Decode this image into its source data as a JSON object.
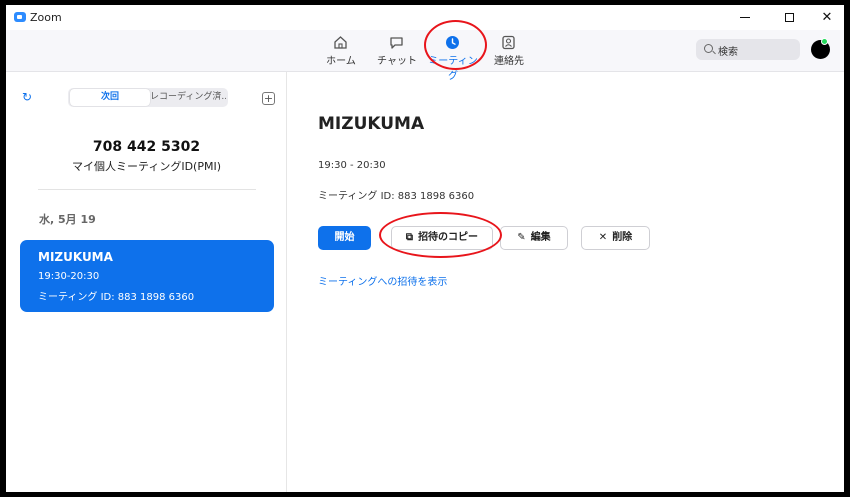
{
  "window": {
    "title": "Zoom"
  },
  "nav": {
    "items": [
      {
        "label": "ホーム",
        "icon": "home-icon"
      },
      {
        "label": "チャット",
        "icon": "chat-icon"
      },
      {
        "label": "ミーティング",
        "icon": "clock-icon",
        "active": true
      },
      {
        "label": "連絡先",
        "icon": "contacts-icon"
      }
    ],
    "search_label": "検索",
    "accent_color": "#0e71eb"
  },
  "sidebar": {
    "tabs": [
      "次回",
      "レコーディング済..."
    ],
    "pmi_number": "708 442 5302",
    "pmi_label": "マイ個人ミーティングID(PMI)",
    "date_header": "水, 5月 19",
    "meeting": {
      "title": "MIZUKUMA",
      "time": "19:30-20:30",
      "id_line": "ミーティング ID: 883 1898 6360"
    }
  },
  "detail": {
    "title": "MIZUKUMA",
    "time": "19:30 - 20:30",
    "id_line": "ミーティング ID: 883 1898 6360",
    "buttons": {
      "start": "開始",
      "copy_invite": "招待のコピー",
      "edit": "編集",
      "delete": "削除"
    },
    "invite_link": "ミーティングへの招待を表示"
  },
  "annotation_color": "#e8151b"
}
